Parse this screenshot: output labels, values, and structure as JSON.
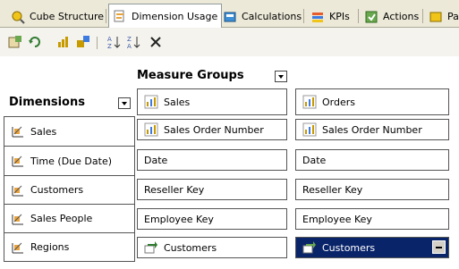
{
  "tabs": [
    {
      "label": "Cube Structure",
      "icon": "cube-structure-icon"
    },
    {
      "label": "Dimension Usage",
      "icon": "dimension-usage-icon",
      "active": true
    },
    {
      "label": "Calculations",
      "icon": "calculations-icon"
    },
    {
      "label": "KPIs",
      "icon": "kpis-icon"
    },
    {
      "label": "Actions",
      "icon": "actions-icon"
    },
    {
      "label": "Pa",
      "icon": "partitions-icon"
    }
  ],
  "toolbar": [
    "add-cube-dimension-icon",
    "refresh-icon",
    "add-measure-group-icon",
    "define-relationship-icon",
    "sort-ascending-icon",
    "sort-descending-icon",
    "delete-icon"
  ],
  "headers": {
    "measure_groups": "Measure Groups",
    "dimensions": "Dimensions"
  },
  "measure_groups": [
    "Sales",
    "Orders"
  ],
  "rows": [
    {
      "dimension": "Sales",
      "cells": [
        "Sales Order Number",
        "Sales Order Number"
      ]
    },
    {
      "dimension": "Time (Due Date)",
      "cells": [
        "Date",
        "Date"
      ]
    },
    {
      "dimension": "Customers",
      "cells": [
        "Reseller Key",
        "Reseller Key"
      ]
    },
    {
      "dimension": "Sales People",
      "cells": [
        "Employee Key",
        "Employee Key"
      ]
    },
    {
      "dimension": "Regions",
      "cells": [
        "Customers",
        "Customers"
      ]
    }
  ],
  "colors": {
    "selection": "#0a246a",
    "tab_background": "#ece9d8"
  }
}
